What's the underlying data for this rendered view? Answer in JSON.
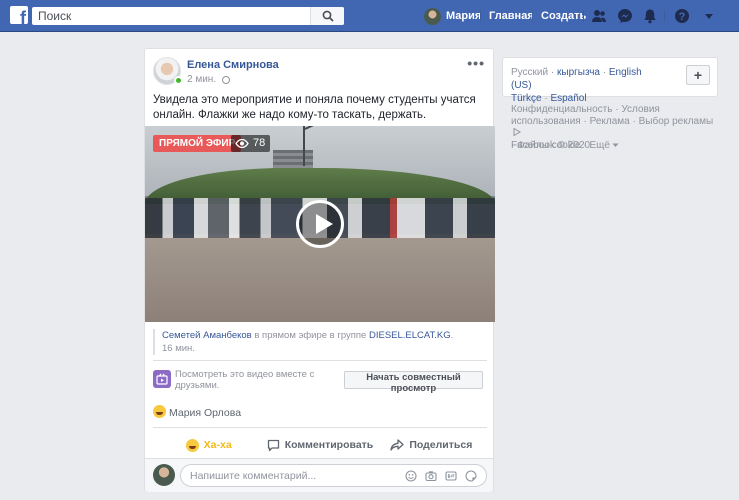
{
  "topbar": {
    "logo": "f",
    "search_placeholder": "Поиск",
    "user_name": "Мария",
    "home": "Главная",
    "create": "Создать",
    "color": "#4267b2"
  },
  "post": {
    "author": "Елена Смирнова",
    "time": "2 мин.",
    "more": "•••",
    "text": "Увидела это мероприятие и поняла почему студенты учатся онлайн. Флажки же надо кому-то таскать, держать.",
    "live_badge": "ПРЯМОЙ ЭФИР",
    "viewer_count": "78",
    "shared_from_user": "Семетей Аманбеков",
    "shared_middle": " в прямом эфире в группе ",
    "shared_group": "DIESEL.ELCAT.KG",
    "shared_end": ".",
    "shared_time": "16 мин.",
    "watch_together_text": "Посмотреть это видео вместе с друзьями.",
    "watch_together_button": "Начать совместный просмотр",
    "reaction_by": "Мария Орлова",
    "actions": {
      "haha": "Ха-ха",
      "comment": "Комментировать",
      "share": "Поделиться"
    },
    "comment_placeholder": "Напишите комментарий..."
  },
  "sidebar": {
    "languages": [
      "Русский",
      "кыргызча",
      "English (US)",
      "Türkçe",
      "Español"
    ],
    "add_language": "+",
    "footer_links": [
      "Конфиденциальность",
      "Условия использования",
      "Реклама",
      "Выбор рекламы",
      "Файлы cookie",
      "Ещё"
    ],
    "copyright": "Facebook © 2020"
  }
}
